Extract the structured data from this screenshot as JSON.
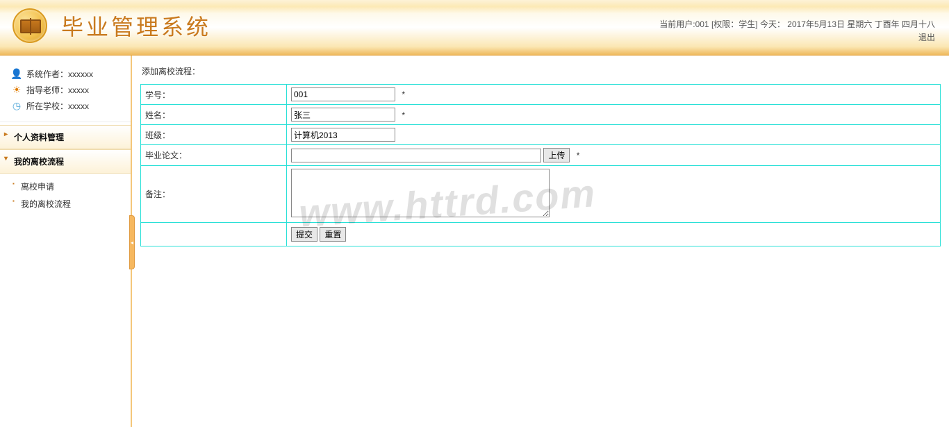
{
  "header": {
    "title": "毕业管理系统",
    "info_line": "当前用户:001 [权限：学生] 今天： 2017年5月13日 星期六 丁酉年 四月十八",
    "logout": "退出"
  },
  "watermark": "www.httrd.com",
  "sidebar": {
    "info": [
      {
        "icon": "user-icon",
        "label": "系统作者：xxxxxx"
      },
      {
        "icon": "teacher-icon",
        "label": "指导老师：xxxxx"
      },
      {
        "icon": "school-icon",
        "label": "所在学校：xxxxx"
      }
    ],
    "sections": [
      {
        "title": "个人资料管理",
        "active": false
      },
      {
        "title": "我的离校流程",
        "active": true
      }
    ],
    "sub_items": [
      {
        "label": "离校申请"
      },
      {
        "label": "我的离校流程"
      }
    ]
  },
  "page": {
    "title": "添加离校流程：",
    "fields": {
      "student_id": {
        "label": "学号：",
        "value": "001",
        "required": "*"
      },
      "name": {
        "label": "姓名：",
        "value": "张三",
        "required": "*"
      },
      "class": {
        "label": "班级：",
        "value": "计算机2013"
      },
      "thesis": {
        "label": "毕业论文：",
        "value": "",
        "upload": "上传",
        "required": "*"
      },
      "remark": {
        "label": "备注：",
        "value": ""
      }
    },
    "buttons": {
      "submit": "提交",
      "reset": "重置"
    }
  }
}
